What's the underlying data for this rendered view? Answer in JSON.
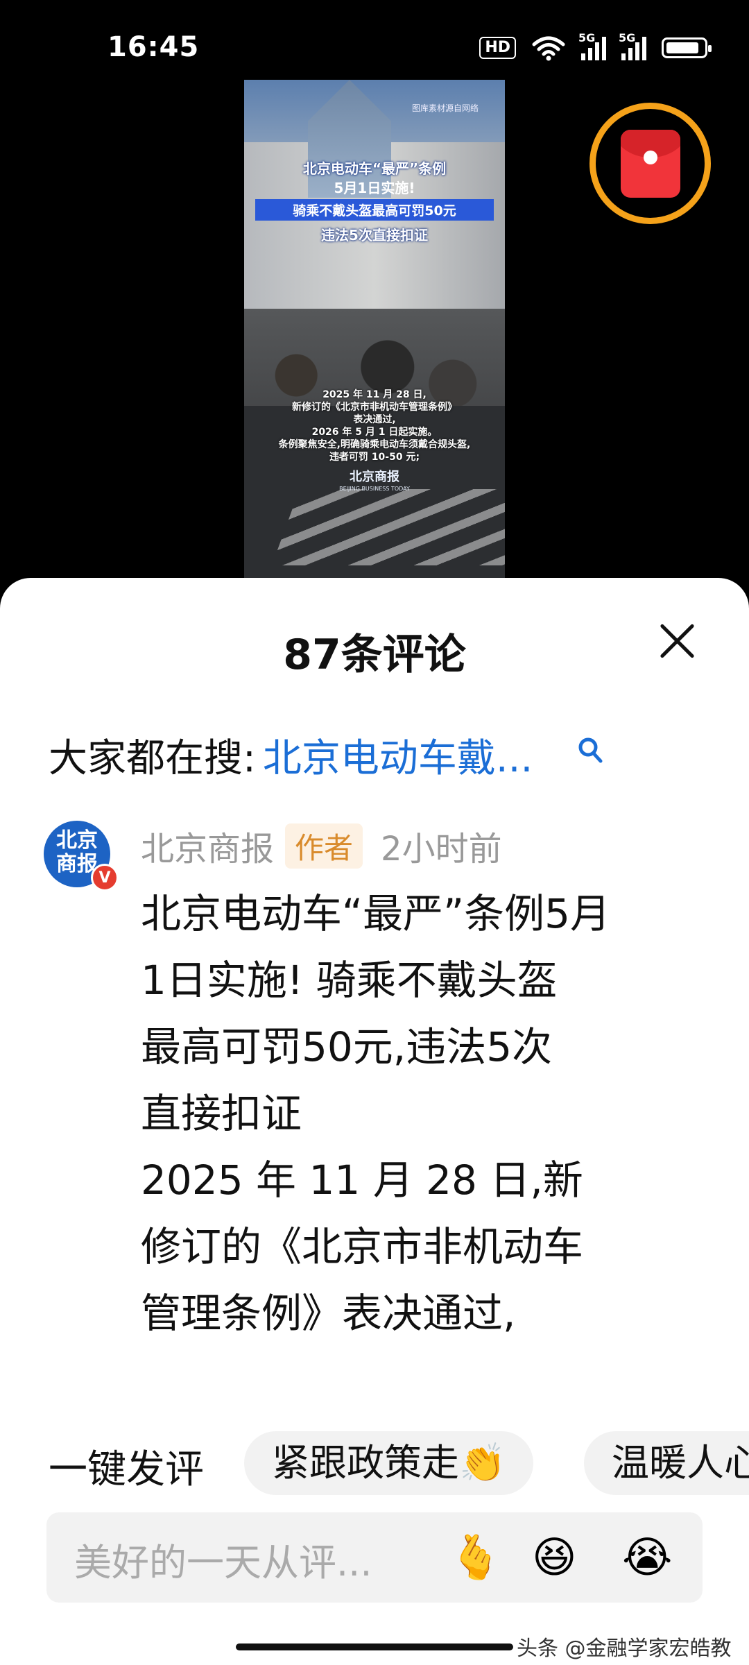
{
  "status": {
    "time": "16:45",
    "hd": "HD",
    "sig1": "5G",
    "sig2": "5G"
  },
  "video": {
    "source_note": "图库素材源自网络",
    "title_line1": "北京电动车“最严”条例",
    "title_line2": "5月1日实施!",
    "title_line3": "骑乘不戴头盔最高可罚50元",
    "title_line4": "违法5次直接扣证",
    "body_lines": [
      "2025 年 11 月 28 日,",
      "新修订的《北京市非机动车管理条例》",
      "表决通过,",
      "2026 年 5 月 1 日起实施。",
      "条例聚焦安全,明确骑乘电动车须戴合规头盔,",
      "违者可罚 10-50 元;"
    ],
    "logo": "北京商报",
    "logo_sub": "BEIJING BUSINESS TODAY"
  },
  "sheet": {
    "title": "87条评论",
    "search_label": "大家都在搜:",
    "search_term": "北京电动车戴..."
  },
  "comment": {
    "avatar_text": "北京\n商报",
    "badge": "V",
    "author": "北京商报",
    "tag": "作者",
    "time": "2小时前",
    "body": "北京电动车“最严”条例5月\n1日实施! 骑乘不戴头盔\n最高可罚50元,违法5次\n直接扣证\n2025 年 11 月 28 日,新\n修订的《北京市非机动车\n管理条例》表决通过,"
  },
  "quick": {
    "label": "一键发评",
    "chips": [
      "紧跟政策走👏",
      "温暖人心"
    ]
  },
  "input": {
    "placeholder": "美好的一天从评...",
    "emojis": [
      "🫰",
      "😆",
      "😭"
    ]
  },
  "watermark": "头条 @金融学家宏皓教授",
  "colors": {
    "link": "#1b6ed6",
    "author_tag": "#d98b2c",
    "red_packet_ring": "#f5a21a"
  }
}
